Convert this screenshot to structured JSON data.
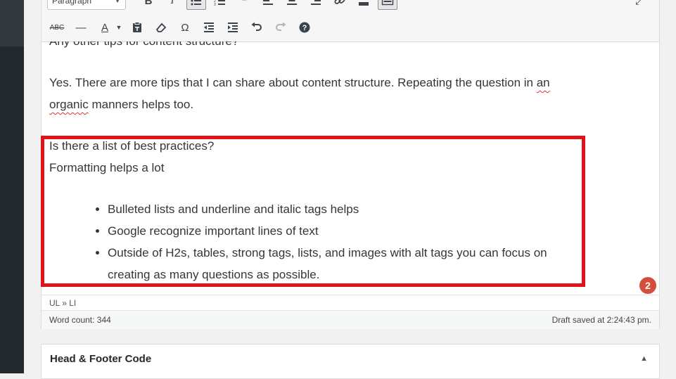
{
  "toolbar": {
    "format_select": "Paragraph",
    "row1_icons": [
      "bold-icon",
      "italic-icon",
      "bulleted-list-icon",
      "numbered-list-icon",
      "blockquote-icon",
      "align-left-icon",
      "align-center-icon",
      "align-right-icon",
      "link-icon",
      "read-more-icon",
      "toolbar-toggle-icon"
    ],
    "row1_active": [
      "bulleted-list-icon",
      "toolbar-toggle-icon"
    ],
    "row2_icons": [
      "strikethrough-icon",
      "horizontal-line-icon",
      "text-color-icon",
      "paste-as-text-icon",
      "clear-formatting-icon",
      "special-character-icon",
      "outdent-icon",
      "indent-icon",
      "undo-icon",
      "redo-icon",
      "help-icon"
    ]
  },
  "editor": {
    "cut_line": "Any other tips for content structure?",
    "para1": {
      "before": "Yes. There are more tips that I can share about content structure. Repeating the question in ",
      "spell1": "an",
      "spell2": "organic",
      "after": " manners helps too."
    },
    "question": "Is there a list of best practices?",
    "answer": "Formatting helps a lot",
    "bullets": [
      "Bulleted lists and underline and italic tags helps",
      "Google recognize important lines of text",
      "Outside of H2s, tables, strong tags, lists, and images with alt tags you can focus on creating as many questions as possible."
    ],
    "notification_count": "2",
    "path": "UL » LI",
    "word_count": "Word count: 344",
    "draft_saved": "Draft saved at 2:24:43 pm."
  },
  "metabox": {
    "title": "Head & Footer Code"
  },
  "colors": {
    "highlight_border": "#e0131a",
    "badge": "#d54e3c",
    "admin_sidebar": "#23282d"
  }
}
